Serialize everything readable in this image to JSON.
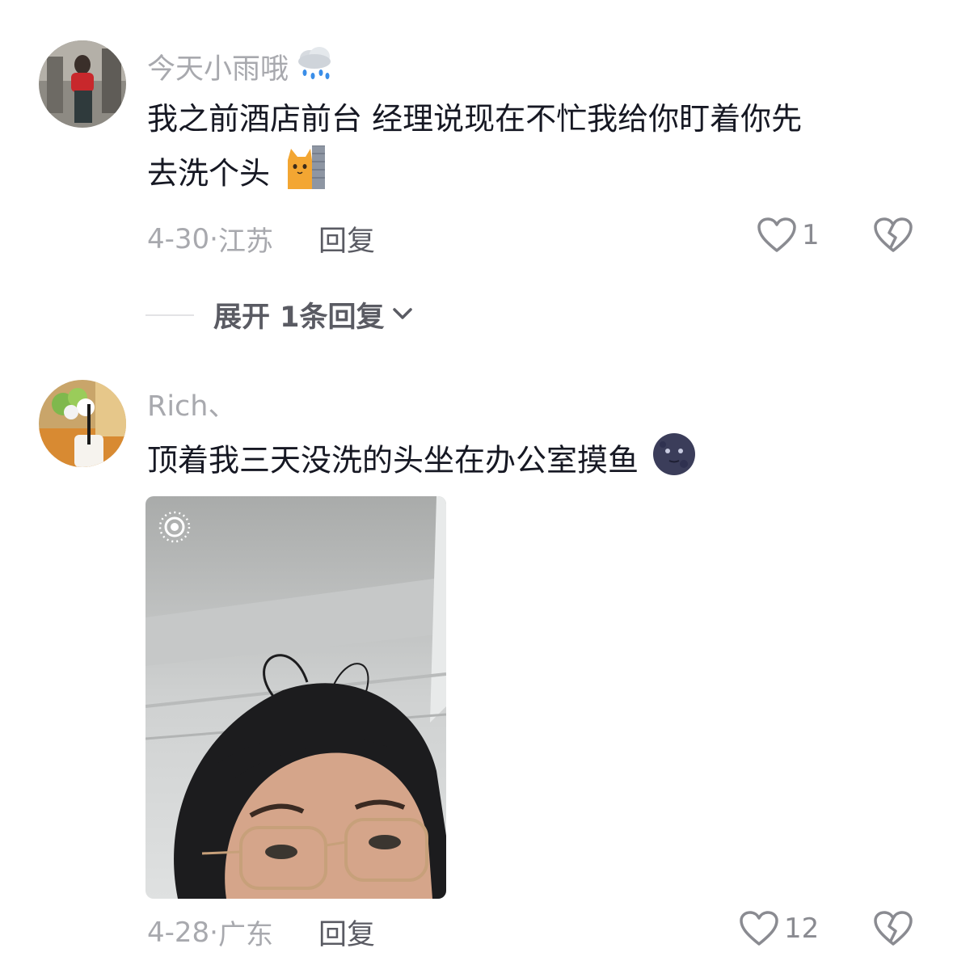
{
  "comments": [
    {
      "username": "今天小雨哦",
      "username_emoji": "rain-cloud-icon",
      "text_line1": "我之前酒店前台 经理说现在不忙我给你盯着你先",
      "text_line2": "去洗个头",
      "text_emoji": "cat-peeking-icon",
      "date": "4-30",
      "location": "江苏",
      "reply_label": "回复",
      "likes": "1",
      "expand_label": "展开 1条回复"
    },
    {
      "username": "Rich、",
      "text_line1": "顶着我三天没洗的头坐在办公室摸鱼",
      "text_emoji": "new-moon-face-icon",
      "has_photo": true,
      "photo_badge": "live-photo-icon",
      "date": "4-28",
      "location": "广东",
      "reply_label": "回复",
      "likes": "12"
    }
  ],
  "colors": {
    "text": "#161823",
    "muted": "#a8a9ae",
    "reply": "#5a5b63",
    "background": "#ffffff"
  }
}
